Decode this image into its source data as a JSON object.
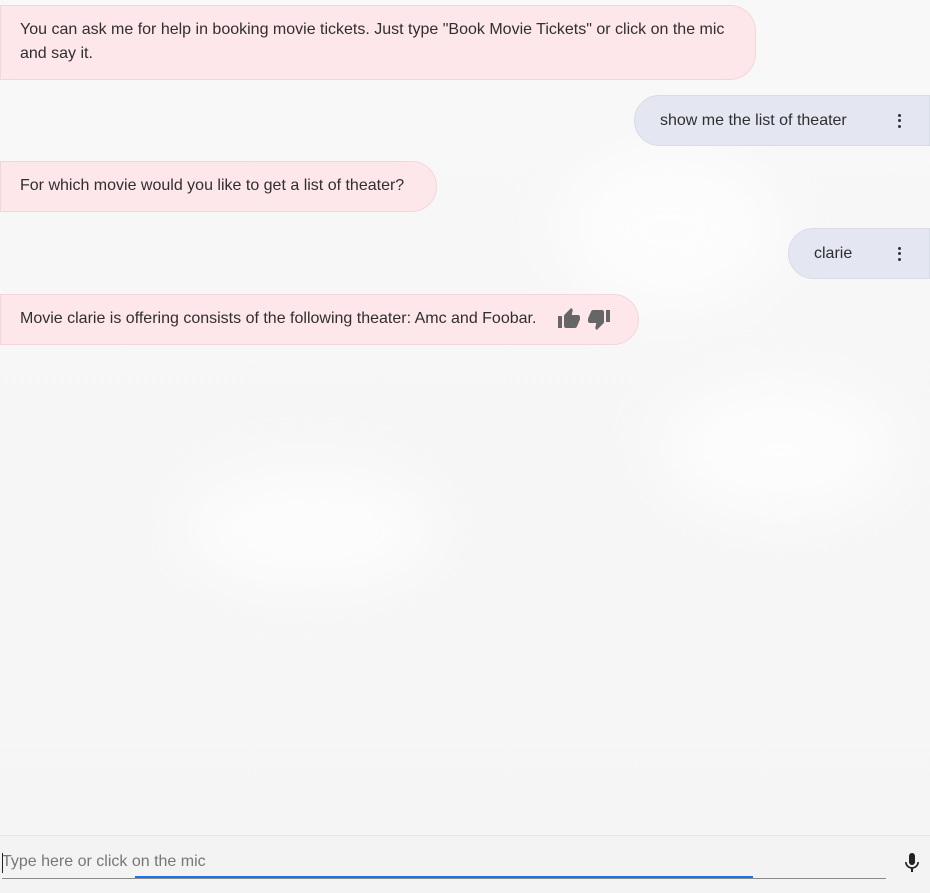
{
  "messages": [
    {
      "role": "bot",
      "text": "You can ask me for help in booking movie tickets. Just type \"Book Movie Tickets\" or click on the mic and say it."
    },
    {
      "role": "user",
      "text": "show me the list of theater"
    },
    {
      "role": "bot",
      "text": "For which movie would you like to get a list of theater?"
    },
    {
      "role": "user",
      "text": "clarie"
    },
    {
      "role": "bot",
      "text": "Movie clarie is offering consists of the following theater: Amc and Foobar."
    }
  ],
  "input": {
    "placeholder": "Type here or click on the mic",
    "value": ""
  },
  "icons": {
    "more": "more-vert-icon",
    "thumbs_up": "thumbs-up-icon",
    "thumbs_down": "thumbs-down-icon",
    "mic": "microphone-icon"
  },
  "colors": {
    "bot_bubble": "#fde7ea",
    "user_bubble": "#e4e7f2",
    "focus_accent": "#1a73e8"
  }
}
